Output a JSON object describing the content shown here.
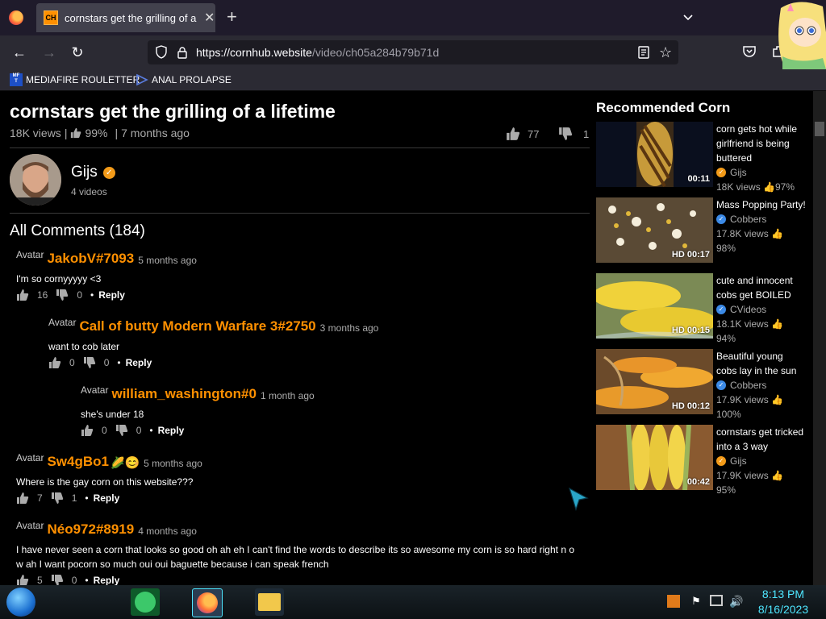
{
  "browser": {
    "tab_title": "cornstars get the grilling of a lifetime",
    "new_tab": "+",
    "url_host": "https://cornhub.website",
    "url_path": "/video/ch05a284b79b71d",
    "bookmarks": [
      {
        "label": "MEDIAFIRE ROULETTER",
        "icon": "mediafire-icon"
      },
      {
        "label": "ANAL PROLAPSE",
        "icon": "bookmark-icon"
      }
    ]
  },
  "video": {
    "title": "cornstars get the grilling of a lifetime",
    "views": "18K views",
    "rating": "99%",
    "age": "7 months ago",
    "likes": "77",
    "dislikes": "1",
    "separator": "|"
  },
  "channel": {
    "name": "Gijs",
    "videos": "4 videos"
  },
  "comments": {
    "heading": "All Comments (184)",
    "reply_label": "Reply",
    "avatar_label": "Avatar",
    "items": [
      {
        "user": "JakobV#7093",
        "time": "5 months ago",
        "text": "I'm so cornyyyyy <3",
        "likes": "16",
        "dislikes": "0"
      },
      {
        "user": "Call of butty Modern Warfare 3#2750",
        "time": "3 months ago",
        "text": "want to cob later",
        "likes": "0",
        "dislikes": "0"
      },
      {
        "user": "william_washington#0",
        "time": "1 month ago",
        "text": "she's under 18",
        "likes": "0",
        "dislikes": "0"
      },
      {
        "user": "Sw4gBo1",
        "time": "5 months ago",
        "text": "Where is the gay corn on this website???",
        "likes": "7",
        "dislikes": "1"
      },
      {
        "user": "Néo972#8919",
        "time": "4 months ago",
        "text": "I have never seen a corn that looks so good oh ah eh I can't find the words to describe its so awesome my corn is so hard right n ow ah I want pocorn so much oui oui baguette because i can speak french",
        "likes": "5",
        "dislikes": "0"
      }
    ]
  },
  "recommended": {
    "heading": "Recommended Corn",
    "items": [
      {
        "title": "corn gets hot while girlfriend is being buttered",
        "author": "Gijs",
        "views": "18K views",
        "rating": "97%",
        "duration": "00:11",
        "verified_color": "#f39b19"
      },
      {
        "title": "Mass Popping Party!",
        "author": "Cobbers",
        "views": "17.8K views",
        "rating": "98%",
        "duration": "HD 00:17",
        "verified_color": "#3c8ae6"
      },
      {
        "title": "cute and innocent cobs get BOILED",
        "author": "CVideos",
        "views": "18.1K views",
        "rating": "94%",
        "duration": "HD 00:15",
        "verified_color": "#3c8ae6"
      },
      {
        "title": "Beautiful young cobs lay in the sun",
        "author": "Cobbers",
        "views": "17.9K views",
        "rating": "100%",
        "duration": "HD 00:12",
        "verified_color": "#3c8ae6"
      },
      {
        "title": "cornstars get tricked into a 3 way",
        "author": "Gijs",
        "views": "17.9K views",
        "rating": "95%",
        "duration": "00:42",
        "verified_color": "#f39b19"
      }
    ]
  },
  "taskbar": {
    "time": "8:13 PM",
    "date": "8/16/2023"
  },
  "colors": {
    "accent": "#ff9000",
    "clock": "#4ee6ff"
  }
}
